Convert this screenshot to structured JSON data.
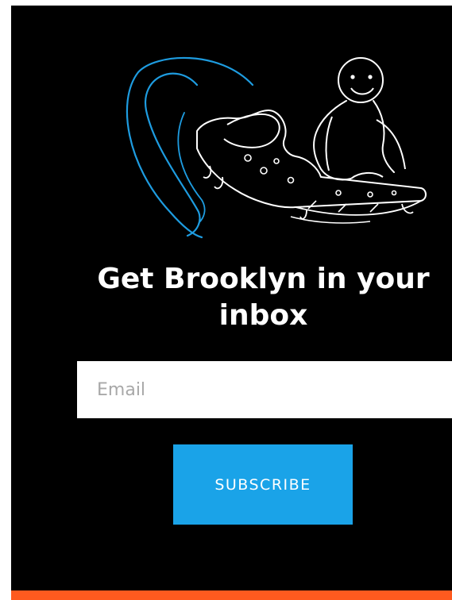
{
  "newsletter": {
    "heading": "Get Brooklyn in your inbox",
    "email_placeholder": "Email",
    "subscribe_label": "SUBSCRIBE",
    "illustration": "pizza-surfer-illustration"
  },
  "colors": {
    "panel_background": "#000000",
    "page_background": "#ffffff",
    "button_background": "#1aa3e8",
    "accent_bar": "#ff5a1f",
    "illustration_line": "#ffffff",
    "illustration_wave": "#1e9ce0"
  }
}
